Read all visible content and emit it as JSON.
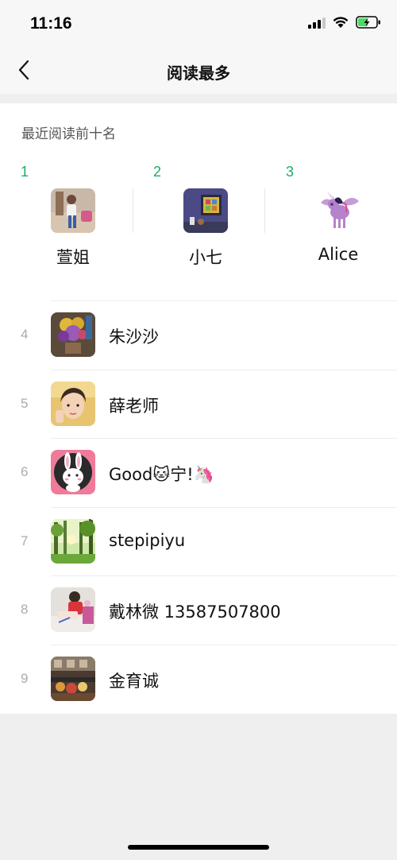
{
  "status_bar": {
    "time": "11:16",
    "icons": [
      "signal-icon",
      "wifi-icon",
      "battery-charging-icon"
    ]
  },
  "nav": {
    "back_icon": "chevron-left-icon",
    "title": "阅读最多"
  },
  "section": {
    "title": "最近阅读前十名"
  },
  "top3": [
    {
      "rank": "1",
      "name": "萱姐"
    },
    {
      "rank": "2",
      "name": "小七"
    },
    {
      "rank": "3",
      "name": "Alice"
    }
  ],
  "list": [
    {
      "rank": "4",
      "name": "朱沙沙"
    },
    {
      "rank": "5",
      "name": "薛老师"
    },
    {
      "rank": "6",
      "name": "Good🐱宁!🦄"
    },
    {
      "rank": "7",
      "name": "stepipiyu"
    },
    {
      "rank": "8",
      "name": "戴林微 13587507800"
    },
    {
      "rank": "9",
      "name": "金育诚"
    }
  ],
  "colors": {
    "accent_green": "#1AAD6A",
    "rank_gray": "#ABABAB",
    "background": "#EFEFEF",
    "card": "#FFFFFF"
  }
}
